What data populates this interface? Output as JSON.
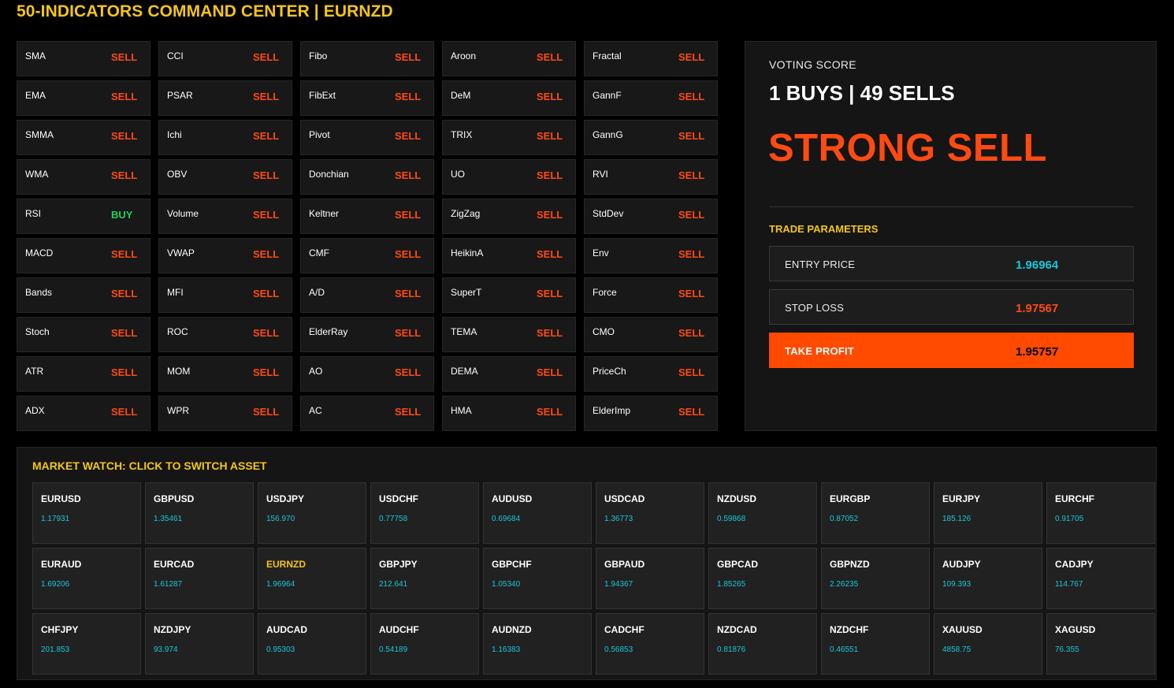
{
  "header": {
    "title": "50-INDICATORS COMMAND CENTER | EURNZD"
  },
  "colors": {
    "sell": "#ff4a12",
    "buy": "#1fd35a",
    "accent": "#f5c518",
    "price": "#19c7d8"
  },
  "indicators": [
    {
      "name": "SMA",
      "signal": "SELL"
    },
    {
      "name": "CCI",
      "signal": "SELL"
    },
    {
      "name": "Fibo",
      "signal": "SELL"
    },
    {
      "name": "Aroon",
      "signal": "SELL"
    },
    {
      "name": "Fractal",
      "signal": "SELL"
    },
    {
      "name": "EMA",
      "signal": "SELL"
    },
    {
      "name": "PSAR",
      "signal": "SELL"
    },
    {
      "name": "FibExt",
      "signal": "SELL"
    },
    {
      "name": "DeM",
      "signal": "SELL"
    },
    {
      "name": "GannF",
      "signal": "SELL"
    },
    {
      "name": "SMMA",
      "signal": "SELL"
    },
    {
      "name": "Ichi",
      "signal": "SELL"
    },
    {
      "name": "Pivot",
      "signal": "SELL"
    },
    {
      "name": "TRIX",
      "signal": "SELL"
    },
    {
      "name": "GannG",
      "signal": "SELL"
    },
    {
      "name": "WMA",
      "signal": "SELL"
    },
    {
      "name": "OBV",
      "signal": "SELL"
    },
    {
      "name": "Donchian",
      "signal": "SELL"
    },
    {
      "name": "UO",
      "signal": "SELL"
    },
    {
      "name": "RVI",
      "signal": "SELL"
    },
    {
      "name": "RSI",
      "signal": "BUY"
    },
    {
      "name": "Volume",
      "signal": "SELL"
    },
    {
      "name": "Keltner",
      "signal": "SELL"
    },
    {
      "name": "ZigZag",
      "signal": "SELL"
    },
    {
      "name": "StdDev",
      "signal": "SELL"
    },
    {
      "name": "MACD",
      "signal": "SELL"
    },
    {
      "name": "VWAP",
      "signal": "SELL"
    },
    {
      "name": "CMF",
      "signal": "SELL"
    },
    {
      "name": "HeikinA",
      "signal": "SELL"
    },
    {
      "name": "Env",
      "signal": "SELL"
    },
    {
      "name": "Bands",
      "signal": "SELL"
    },
    {
      "name": "MFI",
      "signal": "SELL"
    },
    {
      "name": "A/D",
      "signal": "SELL"
    },
    {
      "name": "SuperT",
      "signal": "SELL"
    },
    {
      "name": "Force",
      "signal": "SELL"
    },
    {
      "name": "Stoch",
      "signal": "SELL"
    },
    {
      "name": "ROC",
      "signal": "SELL"
    },
    {
      "name": "ElderRay",
      "signal": "SELL"
    },
    {
      "name": "TEMA",
      "signal": "SELL"
    },
    {
      "name": "CMO",
      "signal": "SELL"
    },
    {
      "name": "ATR",
      "signal": "SELL"
    },
    {
      "name": "MOM",
      "signal": "SELL"
    },
    {
      "name": "AO",
      "signal": "SELL"
    },
    {
      "name": "DEMA",
      "signal": "SELL"
    },
    {
      "name": "PriceCh",
      "signal": "SELL"
    },
    {
      "name": "ADX",
      "signal": "SELL"
    },
    {
      "name": "WPR",
      "signal": "SELL"
    },
    {
      "name": "AC",
      "signal": "SELL"
    },
    {
      "name": "HMA",
      "signal": "SELL"
    },
    {
      "name": "ElderImp",
      "signal": "SELL"
    }
  ],
  "voting": {
    "label": "VOTING SCORE",
    "count": "1 BUYS | 49 SELLS",
    "verdict": "STRONG SELL"
  },
  "trade": {
    "title": "TRADE PARAMETERS",
    "entry": {
      "label": "ENTRY PRICE",
      "value": "1.96964",
      "color": "#19c7d8"
    },
    "stop": {
      "label": "STOP LOSS",
      "value": "1.97567",
      "color": "#ff4a12"
    },
    "take": {
      "label": "TAKE PROFIT",
      "value": "1.95757",
      "color": "#000000"
    }
  },
  "market": {
    "title": "MARKET WATCH: CLICK TO SWITCH ASSET",
    "active": "EURNZD",
    "assets": [
      {
        "symbol": "EURUSD",
        "price": "1.17931"
      },
      {
        "symbol": "GBPUSD",
        "price": "1.35461"
      },
      {
        "symbol": "USDJPY",
        "price": "156.970"
      },
      {
        "symbol": "USDCHF",
        "price": "0.77758"
      },
      {
        "symbol": "AUDUSD",
        "price": "0.69684"
      },
      {
        "symbol": "USDCAD",
        "price": "1.36773"
      },
      {
        "symbol": "NZDUSD",
        "price": "0.59868"
      },
      {
        "symbol": "EURGBP",
        "price": "0.87052"
      },
      {
        "symbol": "EURJPY",
        "price": "185.126"
      },
      {
        "symbol": "EURCHF",
        "price": "0.91705"
      },
      {
        "symbol": "EURAUD",
        "price": "1.69206"
      },
      {
        "symbol": "EURCAD",
        "price": "1.61287"
      },
      {
        "symbol": "EURNZD",
        "price": "1.96964"
      },
      {
        "symbol": "GBPJPY",
        "price": "212.641"
      },
      {
        "symbol": "GBPCHF",
        "price": "1.05340"
      },
      {
        "symbol": "GBPAUD",
        "price": "1.94367"
      },
      {
        "symbol": "GBPCAD",
        "price": "1.85265"
      },
      {
        "symbol": "GBPNZD",
        "price": "2.26235"
      },
      {
        "symbol": "AUDJPY",
        "price": "109.393"
      },
      {
        "symbol": "CADJPY",
        "price": "114.767"
      },
      {
        "symbol": "CHFJPY",
        "price": "201.853"
      },
      {
        "symbol": "NZDJPY",
        "price": "93.974"
      },
      {
        "symbol": "AUDCAD",
        "price": "0.95303"
      },
      {
        "symbol": "AUDCHF",
        "price": "0.54189"
      },
      {
        "symbol": "AUDNZD",
        "price": "1.16383"
      },
      {
        "symbol": "CADCHF",
        "price": "0.56853"
      },
      {
        "symbol": "NZDCAD",
        "price": "0.81876"
      },
      {
        "symbol": "NZDCHF",
        "price": "0.46551"
      },
      {
        "symbol": "XAUUSD",
        "price": "4858.75"
      },
      {
        "symbol": "XAGUSD",
        "price": "76.355"
      }
    ]
  }
}
